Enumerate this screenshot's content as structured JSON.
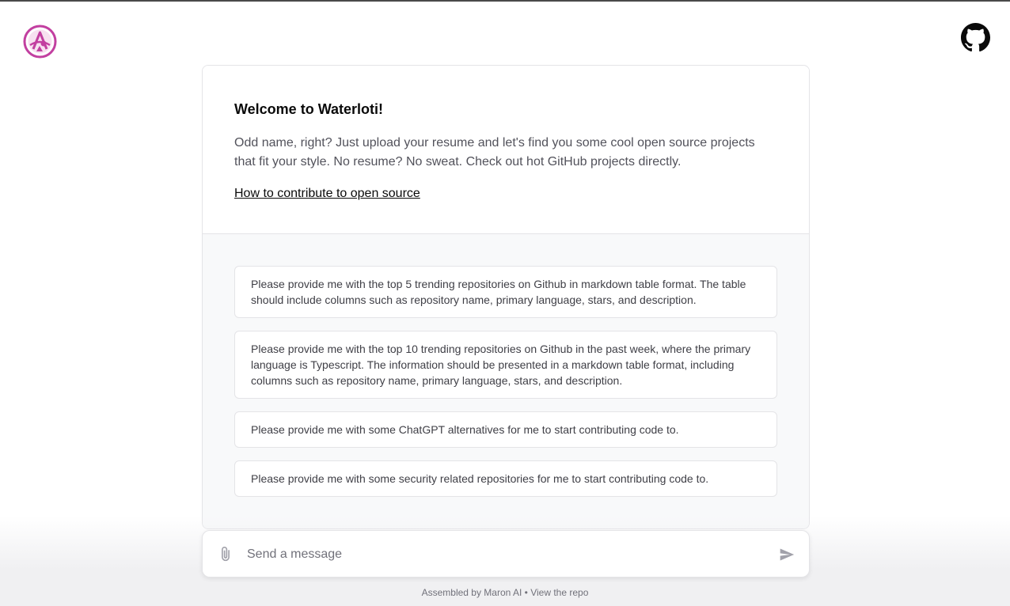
{
  "header": {
    "logo_icon": "waterloti-logo-icon",
    "github_icon": "github-icon"
  },
  "welcome": {
    "title": "Welcome to Waterloti!",
    "description": "Odd name, right? Just upload your resume and let's find you some cool open source projects that fit your style. No resume? No sweat. Check out hot GitHub projects directly.",
    "link_label": "How to contribute to open source"
  },
  "examples": [
    {
      "text": "Please provide me with the top 5 trending repositories on Github in markdown table format. The table should include columns such as repository name, primary language, stars, and description."
    },
    {
      "text": "Please provide me with the top 10 trending repositories on Github in the past week, where the primary language is Typescript. The information should be presented in a markdown table format, including columns such as repository name, primary language, stars, and description."
    },
    {
      "text": "Please provide me with some ChatGPT alternatives for me to start contributing code to."
    },
    {
      "text": "Please provide me with some security related repositories for me to start contributing code to."
    }
  ],
  "composer": {
    "placeholder": "Send a message",
    "attach_icon": "paperclip-icon",
    "send_icon": "send-icon"
  },
  "footer": {
    "assembled_by": "Assembled by Maron AI",
    "separator": "•",
    "repo_link": "View the repo"
  },
  "colors": {
    "brand": "#c23fa0",
    "card_border": "#e4e4e7",
    "examples_bg": "#f8f9fa"
  }
}
